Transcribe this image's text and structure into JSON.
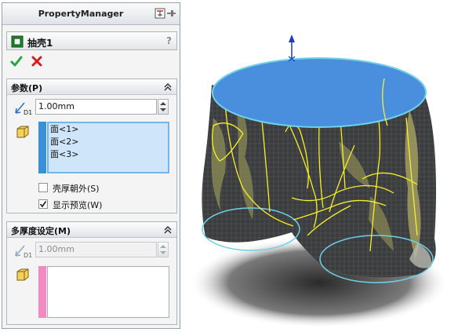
{
  "window": {
    "title": "PropertyManager"
  },
  "feature": {
    "title": "抽壳1",
    "help": "?"
  },
  "groups": {
    "parameters": {
      "title": "参数(P)",
      "thickness": "1.00mm",
      "faces": [
        "面<1>",
        "面<2>",
        "面<3>"
      ],
      "shell_outward": {
        "label": "壳厚朝外(S)",
        "checked": false
      },
      "show_preview": {
        "label": "显示预览(W)",
        "checked": true
      }
    },
    "multi_thickness": {
      "title": "多厚度设定(M)",
      "thickness": "1.00mm",
      "faces": []
    }
  },
  "icons": {
    "window": [
      "pin-icon"
    ],
    "feature": "shell-feature-icon",
    "ok": "checkmark-icon",
    "cancel": "close-icon",
    "group_toggle": "collapse-chevron-icon",
    "distance": "distance-icon",
    "face": "face-cube-icon"
  },
  "colors": {
    "ok": "#22a83a",
    "cancel": "#d81b1b",
    "faces_strip": "#3a8fd9",
    "multi_strip": "#f58ac2",
    "list_selected": "#cfe5fa",
    "model_face": "#4a8fde",
    "model_edges": "#f5f02a",
    "model_body": "#3b3c3e"
  }
}
